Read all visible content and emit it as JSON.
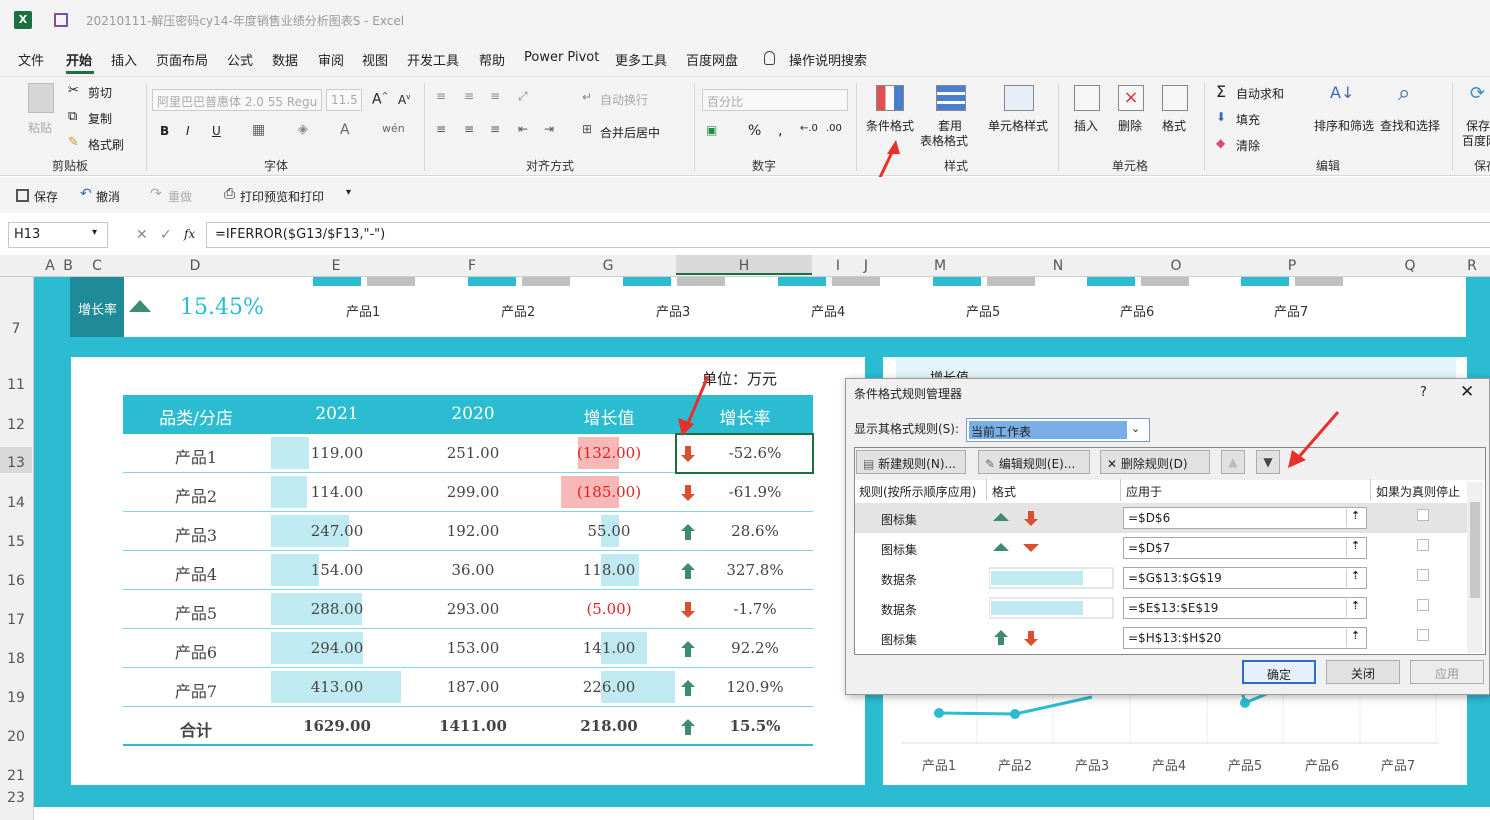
{
  "window": {
    "title": "20210111-解压密码cy14-年度销售业绩分析图表S - Excel"
  },
  "menu": [
    "文件",
    "开始",
    "插入",
    "页面布局",
    "公式",
    "数据",
    "审阅",
    "视图",
    "开发工具",
    "帮助",
    "Power Pivot",
    "更多工具",
    "百度网盘",
    "操作说明搜索"
  ],
  "ribbon": {
    "clipboard": {
      "paste": "粘贴",
      "cut": "剪切",
      "copy": "复制",
      "format_painter": "格式刷",
      "label": "剪贴板"
    },
    "font": {
      "name": "阿里巴巴普惠体 2.0 55 Regu",
      "size": "11.5",
      "bold": "B",
      "italic": "I",
      "underline": "U",
      "label": "字体"
    },
    "align": {
      "wrap": "自动换行",
      "merge": "合并后居中",
      "label": "对齐方式"
    },
    "number": {
      "format": "百分比",
      "label": "数字"
    },
    "styles": {
      "cond": "条件格式",
      "table1": "套用",
      "table2": "表格格式",
      "cell": "单元格样式",
      "label": "样式"
    },
    "cells": {
      "insert": "插入",
      "delete": "删除",
      "format": "格式",
      "label": "单元格"
    },
    "edit": {
      "autosum": "自动求和",
      "fill": "填充",
      "clear": "清除",
      "sort": "排序和筛选",
      "find": "查找和选择",
      "label": "编辑"
    },
    "save": {
      "l1": "保存",
      "l2": "百度网",
      "label": "保存"
    }
  },
  "qat": {
    "save": "保存",
    "undo": "撤消",
    "redo": "重做",
    "print": "打印预览和打印"
  },
  "formula_bar": {
    "namebox": "H13",
    "formula": "=IFERROR($G13/$F13,\"-\")",
    "fx": "fx"
  },
  "columns": [
    "A",
    "B",
    "C",
    "D",
    "E",
    "F",
    "G",
    "H",
    "I",
    "J",
    "K",
    "L",
    "M",
    "N",
    "O",
    "P",
    "Q",
    "R"
  ],
  "rows": [
    "7",
    "11",
    "12",
    "13",
    "14",
    "15",
    "16",
    "17",
    "18",
    "19",
    "20",
    "21",
    "23"
  ],
  "top_strip": {
    "label": "增长率",
    "value": "15.45%",
    "products": [
      "产品1",
      "产品2",
      "产品3",
      "产品4",
      "产品5",
      "产品6",
      "产品7"
    ]
  },
  "table": {
    "unit": "单位：万元",
    "headers": [
      "品类/分店",
      "2021",
      "2020",
      "增长值",
      "增长率"
    ],
    "rows": [
      {
        "name": "产品1",
        "y2021": "119.00",
        "y2020": "251.00",
        "diff": "(132.00)",
        "rate": "-52.6%",
        "up": false,
        "neg": true,
        "bar2021": 0.29,
        "bardiff": 0.71
      },
      {
        "name": "产品2",
        "y2021": "114.00",
        "y2020": "299.00",
        "diff": "(185.00)",
        "rate": "-61.9%",
        "up": false,
        "neg": true,
        "bar2021": 0.28,
        "bardiff": 1.0
      },
      {
        "name": "产品3",
        "y2021": "247.00",
        "y2020": "192.00",
        "diff": "55.00",
        "rate": "28.6%",
        "up": true,
        "neg": false,
        "bar2021": 0.6,
        "bardiff": 0.24
      },
      {
        "name": "产品4",
        "y2021": "154.00",
        "y2020": "36.00",
        "diff": "118.00",
        "rate": "327.8%",
        "up": true,
        "neg": false,
        "bar2021": 0.37,
        "bardiff": 0.52
      },
      {
        "name": "产品5",
        "y2021": "288.00",
        "y2020": "293.00",
        "diff": "(5.00)",
        "rate": "-1.7%",
        "up": false,
        "neg": true,
        "bar2021": 0.7,
        "bardiff": 0.0
      },
      {
        "name": "产品6",
        "y2021": "294.00",
        "y2020": "153.00",
        "diff": "141.00",
        "rate": "92.2%",
        "up": true,
        "neg": false,
        "bar2021": 0.71,
        "bardiff": 0.62
      },
      {
        "name": "产品7",
        "y2021": "413.00",
        "y2020": "187.00",
        "diff": "226.00",
        "rate": "120.9%",
        "up": true,
        "neg": false,
        "bar2021": 1.0,
        "bardiff": 1.0
      }
    ],
    "total": {
      "name": "合计",
      "y2021": "1629.00",
      "y2020": "1411.00",
      "diff": "218.00",
      "rate": "15.5%"
    }
  },
  "right_chart": {
    "title": "增长值",
    "products": [
      "产品1",
      "产品2",
      "产品3",
      "产品4",
      "产品5",
      "产品6",
      "产品7"
    ]
  },
  "dialog": {
    "title": "条件格式规则管理器",
    "help": "?",
    "show_label": "显示其格式规则(S):",
    "show_value": "当前工作表",
    "new_rule": "新建规则(N)...",
    "edit_rule": "编辑规则(E)...",
    "delete_rule": "删除规则(D)",
    "col_rule": "规则(按所示顺序应用)",
    "col_format": "格式",
    "col_apply": "应用于",
    "col_stop": "如果为真则停止",
    "rules": [
      {
        "type": "图标集",
        "apply": "=$D$6",
        "fmt": "icons1"
      },
      {
        "type": "图标集",
        "apply": "=$D$7",
        "fmt": "icons2"
      },
      {
        "type": "数据条",
        "apply": "=$G$13:$G$19",
        "fmt": "bar"
      },
      {
        "type": "数据条",
        "apply": "=$E$13:$E$19",
        "fmt": "bar"
      },
      {
        "type": "图标集",
        "apply": "=$H$13:$H$20",
        "fmt": "icons3"
      }
    ],
    "ok": "确定",
    "close": "关闭",
    "apply": "应用"
  },
  "colors": {
    "accent": "#2bbcd1",
    "header": "#2bbcd1",
    "bar": "#bfeaf2",
    "negbar": "#f9b8b8",
    "up": "#3d8c6e",
    "down": "#d9502e",
    "red_arrow": "#e8302a"
  }
}
